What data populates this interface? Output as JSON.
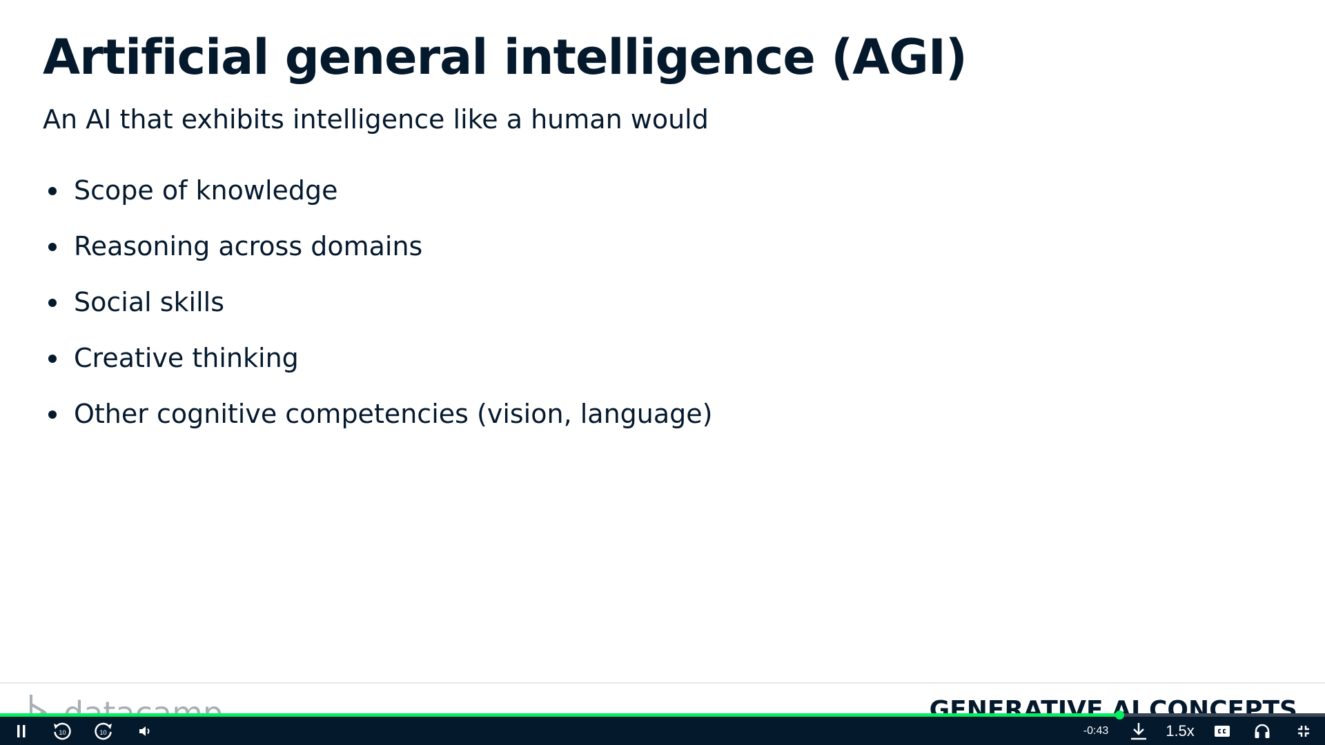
{
  "slide": {
    "title": "Artificial general intelligence (AGI)",
    "subtitle": "An AI that exhibits intelligence like a human would",
    "bullets": [
      "Scope of knowledge",
      "Reasoning across domains",
      "Social skills",
      "Creative thinking",
      "Other cognitive competencies (vision, language)"
    ],
    "footer_logo_text": "datacamp",
    "footer_course": "GENERATIVE AI CONCEPTS"
  },
  "player": {
    "progress_fraction": 0.845,
    "time_remaining": "-0:43",
    "playback_speed": "1.5x",
    "skip_back_seconds": "10",
    "skip_forward_seconds": "10",
    "icons": {
      "pause": "pause-icon",
      "rewind": "rewind-10-icon",
      "forward": "forward-10-icon",
      "volume": "volume-icon",
      "download": "download-icon",
      "captions": "captions-icon",
      "audio": "headphones-icon",
      "exit_fullscreen": "exit-fullscreen-icon"
    },
    "colors": {
      "progress": "#03ef62",
      "bar": "#05192d",
      "track": "#3b4656"
    }
  }
}
